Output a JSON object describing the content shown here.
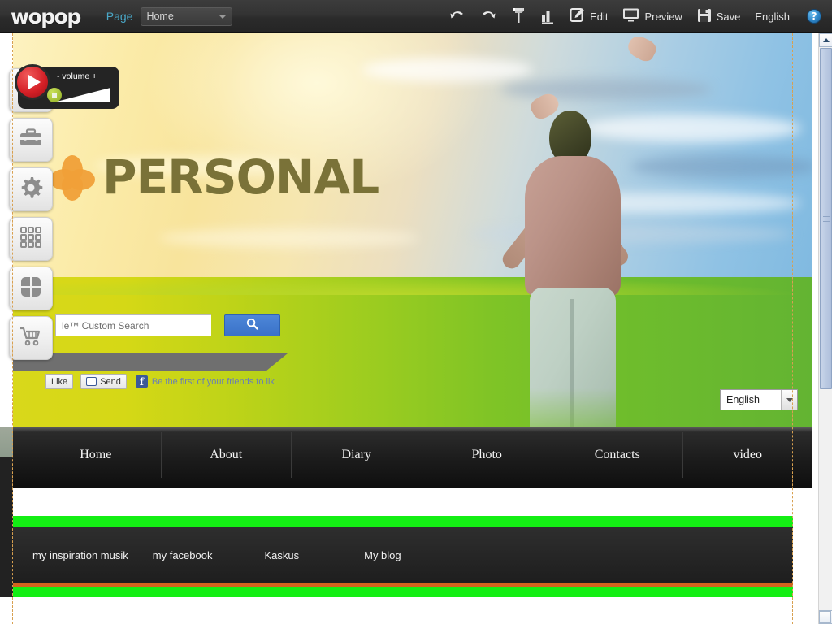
{
  "toolbar": {
    "brand": "wopop",
    "page_label": "Page",
    "page_selected": "Home",
    "undo": "undo-arrow",
    "redo": "redo-arrow",
    "crane": "crane-tool",
    "stats": "bar-chart",
    "edit_label": "Edit",
    "preview_label": "Preview",
    "save_label": "Save",
    "language_label": "English",
    "help_label": "?"
  },
  "sidebar": {
    "items": [
      {
        "name": "add",
        "icon": "plus-icon"
      },
      {
        "name": "tools",
        "icon": "toolbox-icon"
      },
      {
        "name": "settings",
        "icon": "gear-icon"
      },
      {
        "name": "grid",
        "icon": "grid-icon"
      },
      {
        "name": "apps",
        "icon": "clover-icon"
      },
      {
        "name": "cart",
        "icon": "shopping-cart-icon"
      }
    ]
  },
  "music": {
    "volume_label": "- volume +",
    "play_icon": "play-icon",
    "stop_icon": "stop-icon"
  },
  "hero": {
    "site_title": "PERSONAL",
    "flower_icon": "flower-icon",
    "search_placeholder": "le™ Custom Search",
    "search_button_icon": "search-icon",
    "language_value": "English"
  },
  "facebook": {
    "like_label": "Like",
    "send_label": "Send",
    "f_glyph": "f",
    "promo_text": "Be the first of your friends to lik"
  },
  "nav": {
    "items": [
      "Home",
      "About",
      "Diary",
      "Photo",
      "Contacts",
      "video"
    ]
  },
  "footer": {
    "links": [
      "my inspiration musik",
      "my facebook",
      "Kaskus",
      "My blog"
    ],
    "colors": {
      "green_bar": "#14ee14",
      "orange_bar": "#d2641e",
      "panel": "#272727"
    }
  },
  "colors": {
    "toolbar_bg": "#2f2f2f",
    "accent_blue": "#4aa8c8",
    "title_olive": "#7a7238",
    "flower_orange": "#f0a038",
    "search_blue": "#3a72c8"
  }
}
